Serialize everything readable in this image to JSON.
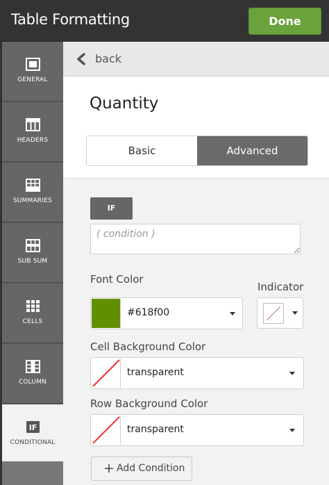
{
  "header": {
    "title": "Table Formatting",
    "done_label": "Done"
  },
  "sidebar": {
    "items": [
      {
        "label": "GENERAL",
        "icon": "general-icon"
      },
      {
        "label": "HEADERS",
        "icon": "headers-icon"
      },
      {
        "label": "SUMMARIES",
        "icon": "summaries-icon"
      },
      {
        "label": "SUB SUM",
        "icon": "sub-sum-icon"
      },
      {
        "label": "CELLS",
        "icon": "cells-icon"
      },
      {
        "label": "COLUMN",
        "icon": "column-icon"
      },
      {
        "label": "CONDITIONAL",
        "icon": "conditional-icon",
        "active": true
      }
    ]
  },
  "main": {
    "back_label": "back",
    "field_title": "Quantity",
    "mode_tabs": {
      "basic": "Basic",
      "advanced": "Advanced",
      "selected": "Advanced"
    },
    "condition": {
      "if_label": "IF",
      "placeholder": "( condition )",
      "value": ""
    },
    "font_color": {
      "label": "Font Color",
      "value": "#618f00",
      "swatch": "#618f00"
    },
    "indicator": {
      "label": "Indicator",
      "value": "none"
    },
    "cell_background": {
      "label": "Cell Background Color",
      "value": "transparent"
    },
    "row_background": {
      "label": "Row Background Color",
      "value": "transparent"
    },
    "add_condition_label": "Add Condition"
  },
  "colors": {
    "accent_green": "#6aa23c",
    "topbar": "#333333",
    "sidebar": "#666666",
    "advanced_tab": "#6a6a6a"
  }
}
